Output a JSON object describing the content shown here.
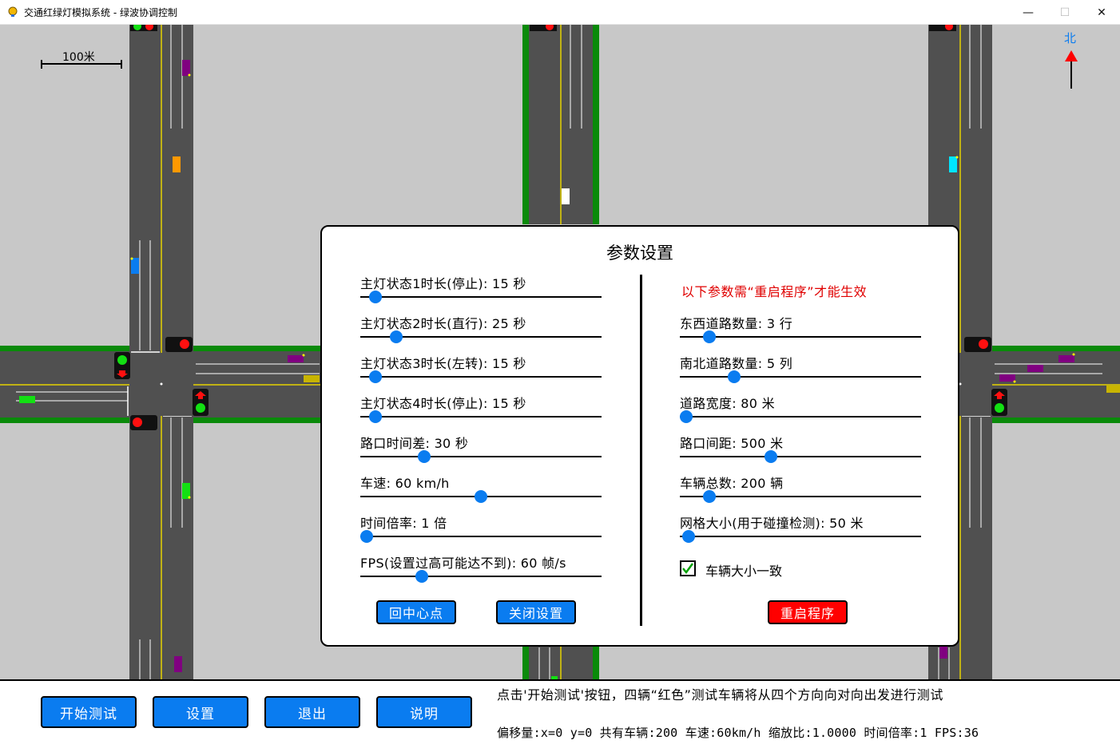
{
  "window": {
    "title": "交通红绿灯模拟系统 - 绿波协调控制",
    "minimize_glyph": "—",
    "maximize_glyph": "☐",
    "close_glyph": "✕"
  },
  "map": {
    "scale_label": "100米",
    "north_label": "北"
  },
  "settings": {
    "title": "参数设置",
    "restart_note": "以下参数需“重启程序”才能生效",
    "left_params": [
      {
        "label": "主灯状态1时长(停止): 15 秒",
        "value": 15,
        "level": 0.04
      },
      {
        "label": "主灯状态2时长(直行): 25 秒",
        "value": 25,
        "level": 0.13
      },
      {
        "label": "主灯状态3时长(左转): 15 秒",
        "value": 15,
        "level": 0.04
      },
      {
        "label": "主灯状态4时长(停止): 15 秒",
        "value": 15,
        "level": 0.04
      },
      {
        "label": "路口时间差: 30 秒",
        "value": 30,
        "level": 0.25
      },
      {
        "label": "车速: 60 km/h",
        "value": 60,
        "level": 0.5
      },
      {
        "label": "时间倍率: 1 倍",
        "value": 1,
        "level": 0.0
      },
      {
        "label": "FPS(设置过高可能达不到): 60 帧/s",
        "value": 60,
        "level": 0.24
      }
    ],
    "right_params": [
      {
        "label": "东西道路数量: 3 行",
        "value": 3,
        "level": 0.1
      },
      {
        "label": "南北道路数量: 5 列",
        "value": 5,
        "level": 0.21
      },
      {
        "label": "道路宽度: 80 米",
        "value": 80,
        "level": 0.0
      },
      {
        "label": "路口间距: 500 米",
        "value": 500,
        "level": 0.37
      },
      {
        "label": "车辆总数: 200 辆",
        "value": 200,
        "level": 0.1
      },
      {
        "label": "网格大小(用于碰撞检测): 50 米",
        "value": 50,
        "level": 0.01
      }
    ],
    "same_size_label": "车辆大小一致",
    "same_size_checked": true,
    "center_button": "回中心点",
    "close_button": "关闭设置",
    "restart_button": "重启程序"
  },
  "bottom": {
    "start_button": "开始测试",
    "settings_button": "设置",
    "exit_button": "退出",
    "help_button": "说明",
    "hint": "点击'开始测试'按钮，四辆“红色”测试车辆将从四个方向向对向出发进行测试",
    "status": "偏移量:x=0 y=0 共有车辆:200  车速:60km/h 缩放比:1.0000 时间倍率:1 FPS:36"
  },
  "colors": {
    "accent": "#0a7cf0",
    "danger": "#ff0000",
    "road": "#505050",
    "ground": "#c8c8c8",
    "green_belt": "#0a8a0a",
    "center_line": "#e6d200"
  }
}
